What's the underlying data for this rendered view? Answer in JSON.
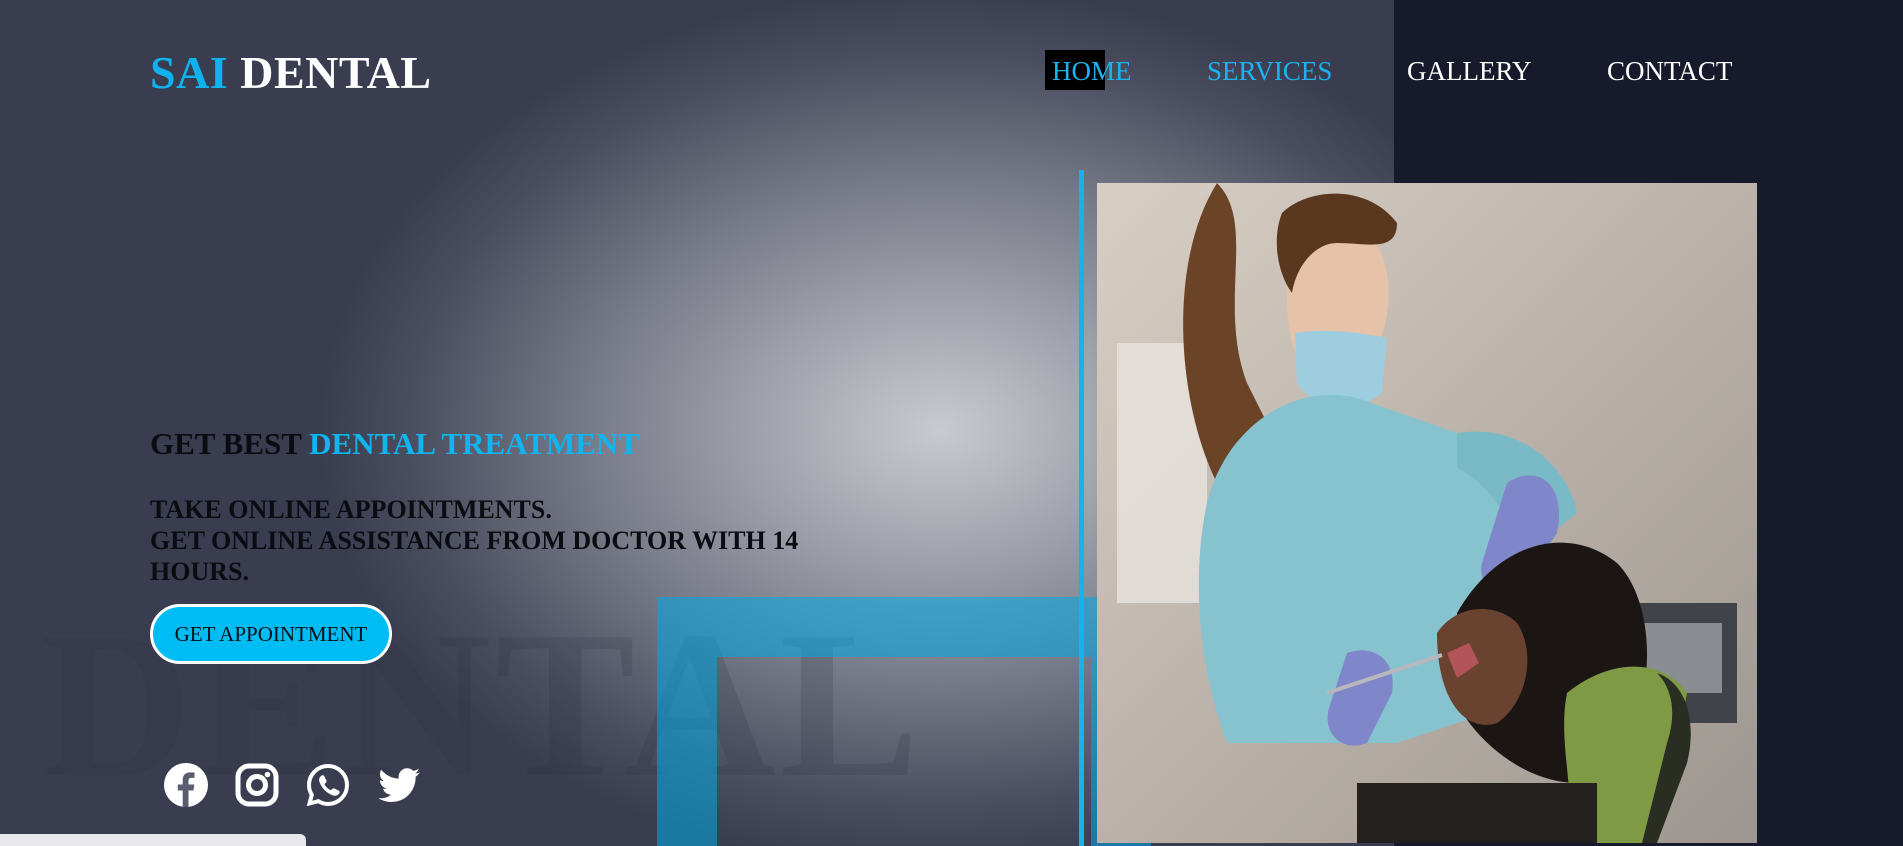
{
  "brand": {
    "part1": "SAI",
    "part2": "DENTAL"
  },
  "nav": {
    "items": [
      {
        "label": "HOME"
      },
      {
        "label": "SERVICES"
      },
      {
        "label": "GALLERY"
      },
      {
        "label": "CONTACT"
      }
    ]
  },
  "hero": {
    "headline_prefix": "GET BEST",
    "headline_accent": "DENTAL TREATMENT",
    "line1": "TAKE ONLINE APPOINTMENTS.",
    "line2": "GET ONLINE ASSISTANCE FROM DOCTOR WITH 14 HOURS.",
    "cta_label": "GET APPOINTMENT",
    "watermark": "DENTAL"
  },
  "socials": [
    {
      "icon": "facebook-icon"
    },
    {
      "icon": "instagram-icon"
    },
    {
      "icon": "whatsapp-icon"
    },
    {
      "icon": "twitter-icon"
    }
  ],
  "status_bar": {
    "text": ""
  },
  "colors": {
    "accent": "#0fb2ee",
    "button": "#00bcf5",
    "panel": "#161a2b"
  }
}
